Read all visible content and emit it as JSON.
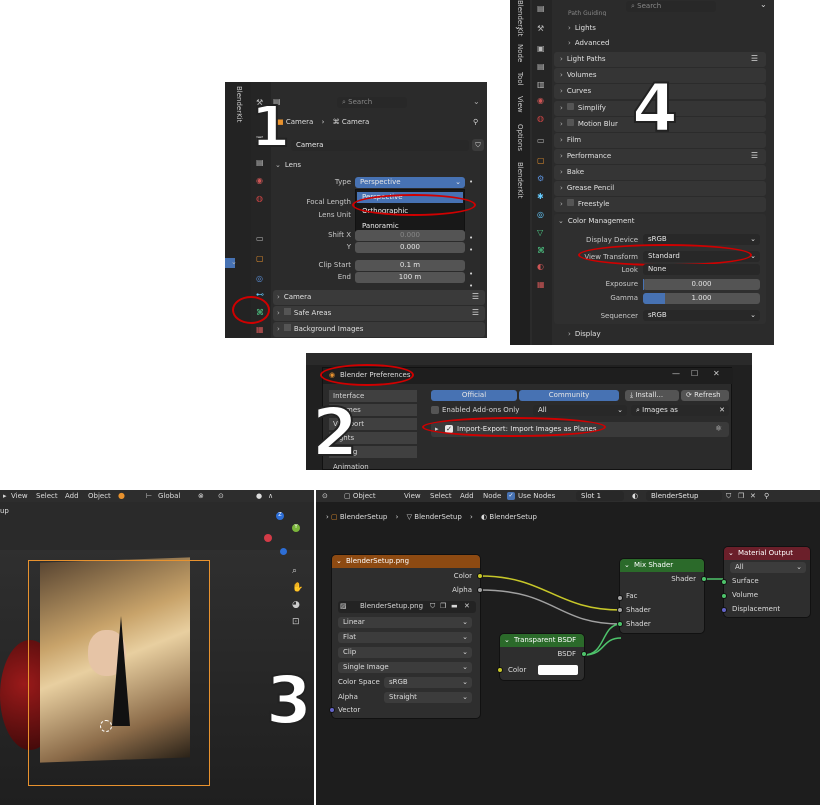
{
  "panel1": {
    "tab": "BlenderKit",
    "search_placeholder": "Search",
    "breadcrumb_a": "Camera",
    "breadcrumb_b": "Camera",
    "datablock_name": "Camera",
    "lens_label": "Lens",
    "type_label": "Type",
    "type_value": "Perspective",
    "dropdown_options": [
      "Perspective",
      "Orthographic",
      "Panoramic"
    ],
    "focal_label": "Focal Length",
    "lens_unit_label": "Lens Unit",
    "shiftx_label": "Shift X",
    "shiftx_value": "0.000",
    "y_label": "Y",
    "y_value": "0.000",
    "clipstart_label": "Clip Start",
    "clipstart_value": "0.1 m",
    "end_label": "End",
    "end_value": "100 m",
    "camera_section": "Camera",
    "safe_areas": "Safe Areas",
    "bg_images": "Background Images"
  },
  "panel4": {
    "tabs": [
      "Node",
      "Tool",
      "View",
      "Options",
      "BlenderKit"
    ],
    "search_placeholder": "Search",
    "top_cut": "Path Guiding",
    "lights": "Lights",
    "advanced": "Advanced",
    "sections": [
      "Light Paths",
      "Volumes",
      "Curves",
      "Simplify",
      "Motion Blur",
      "Film",
      "Performance",
      "Bake",
      "Grease Pencil",
      "Freestyle"
    ],
    "color_mgmt": "Color Management",
    "display_device_label": "Display Device",
    "display_device_value": "sRGB",
    "view_transform_label": "View Transform",
    "view_transform_value": "Standard",
    "look_label": "Look",
    "look_value": "None",
    "exposure_label": "Exposure",
    "exposure_value": "0.000",
    "gamma_label": "Gamma",
    "gamma_value": "1.000",
    "sequencer_label": "Sequencer",
    "sequencer_value": "sRGB",
    "display": "Display"
  },
  "panel2": {
    "title": "Blender Preferences",
    "sidebar": [
      "Interface",
      "Themes",
      "Viewport",
      "Lights",
      "Editing",
      "Animation"
    ],
    "tab_official": "Official",
    "tab_community": "Community",
    "install": "Install...",
    "refresh": "Refresh",
    "enabled_only": "Enabled Add-ons Only",
    "category_value": "All",
    "search_value": "Images as",
    "addon_name": "Import-Export: Import Images as Planes"
  },
  "viewport": {
    "menu": [
      "View",
      "Select",
      "Add",
      "Object"
    ],
    "orientation": "Global",
    "left_cut": "up"
  },
  "node_editor": {
    "object_label": "Object",
    "menu": [
      "View",
      "Select",
      "Add",
      "Node"
    ],
    "use_nodes": "Use Nodes",
    "slot": "Slot 1",
    "material": "BlenderSetup",
    "breadcrumb": [
      "BlenderSetup",
      "BlenderSetup",
      "BlenderSetup"
    ],
    "image_node": {
      "title": "BlenderSetup.png",
      "out_color": "Color",
      "out_alpha": "Alpha",
      "image_name": "BlenderSetup.png",
      "interp": "Linear",
      "projection": "Flat",
      "extension": "Clip",
      "source": "Single Image",
      "color_space_label": "Color Space",
      "color_space_value": "sRGB",
      "alpha_label": "Alpha",
      "alpha_value": "Straight",
      "in_vector": "Vector"
    },
    "mix_node": {
      "title": "Mix Shader",
      "out_shader": "Shader",
      "in_fac": "Fac",
      "in_shader1": "Shader",
      "in_shader2": "Shader"
    },
    "transparent_node": {
      "title": "Transparent BSDF",
      "out_bsdf": "BSDF",
      "in_color": "Color"
    },
    "output_node": {
      "title": "Material Output",
      "target": "All",
      "in_surface": "Surface",
      "in_volume": "Volume",
      "in_displacement": "Displacement"
    }
  },
  "step_numbers": [
    "1",
    "2",
    "3",
    "4"
  ],
  "colors": {
    "highlight_red": "#d00000",
    "blender_blue": "#4772b3",
    "image_node_header": "#8d4a12",
    "shader_node_header": "#2b6a2a",
    "output_node_header": "#6b1f2a"
  }
}
